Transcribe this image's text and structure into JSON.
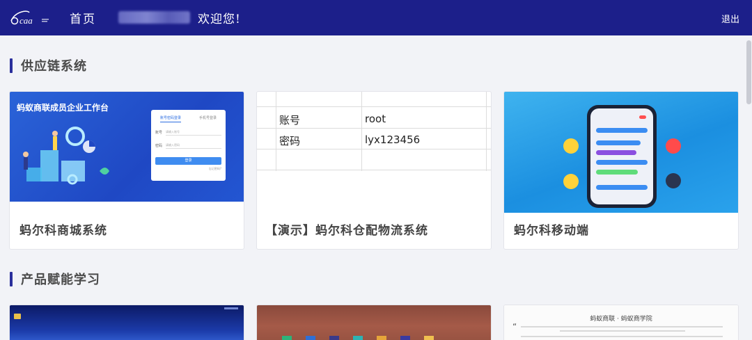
{
  "header": {
    "logo_text": "caa",
    "nav_home": "首页",
    "welcome": "欢迎您!",
    "logout": "退出"
  },
  "sections": [
    {
      "title": "供应链系统"
    },
    {
      "title": "产品赋能学习"
    }
  ],
  "cards": [
    {
      "caption": "蚂尔科商城系统",
      "preview_title": "蚂蚁商联成员企业工作台",
      "login_tabs": [
        "账号密码登录",
        "手机号登录"
      ],
      "login_fields": [
        "账号",
        "密码"
      ],
      "login_placeholders": [
        "请输入账号",
        "请输入密码"
      ],
      "login_button": "登录",
      "login_forgot": "忘记密码?"
    },
    {
      "caption": "【演示】蚂尔科仓配物流系统",
      "credentials": [
        {
          "label": "账号",
          "value": "root"
        },
        {
          "label": "密码",
          "value": "lyx123456"
        }
      ]
    },
    {
      "caption": "蚂尔科移动端"
    }
  ],
  "bottom_cards": [
    {
      "preview": "desktop"
    },
    {
      "preview": "shelf"
    },
    {
      "preview_title": "蚂蚁商联 · 蚂蚁商学院"
    }
  ],
  "colors": {
    "header_bg": "#1c1f8a",
    "accent": "#2a2f9c",
    "page_bg": "#f2f3f7"
  }
}
